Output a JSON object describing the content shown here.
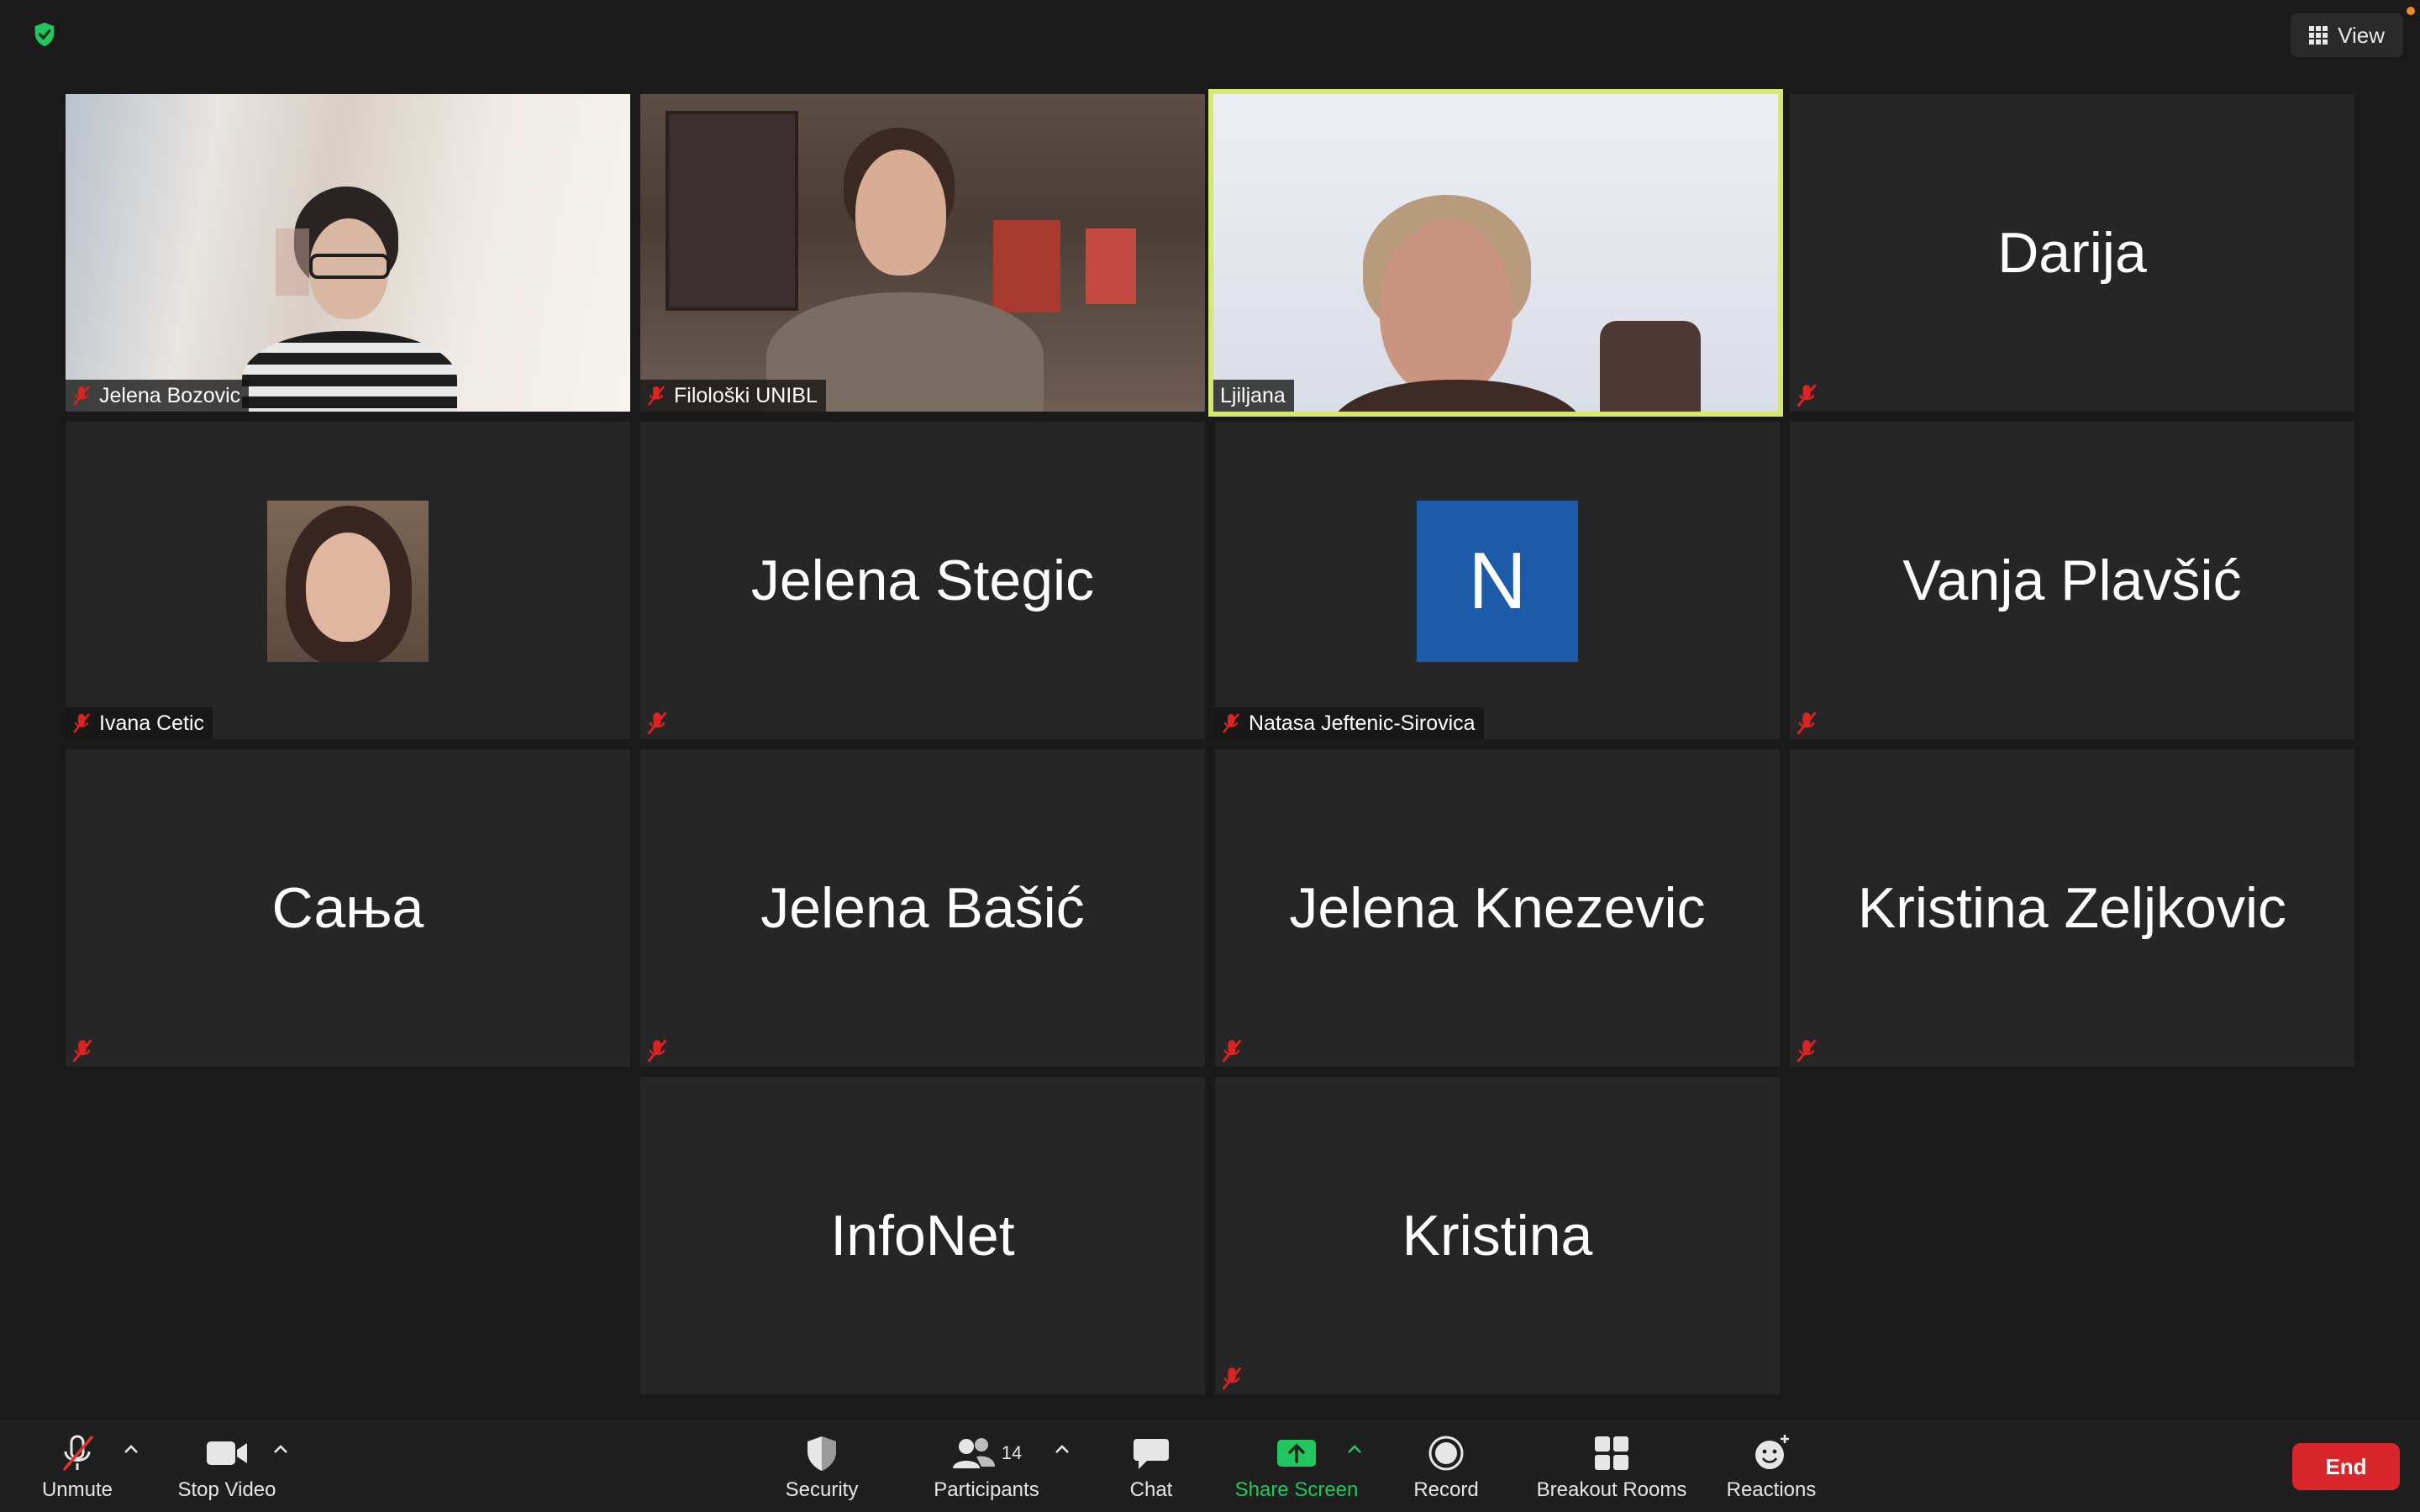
{
  "top": {
    "view_label": "View",
    "accent_green": "#22c55e",
    "active_border": "#d6e86f"
  },
  "tiles": [
    {
      "name": "Jelena Bozovic",
      "mode": "video"
    },
    {
      "name": "Filološki UNIBL",
      "mode": "video"
    },
    {
      "name": "Ljiljana",
      "mode": "video",
      "active": true
    },
    {
      "name": "Darija",
      "mode": "name"
    },
    {
      "name": "Ivana Cetic",
      "mode": "photo"
    },
    {
      "name": "Jelena Stegic",
      "mode": "name"
    },
    {
      "name": "Natasa Jeftenic-Sirovica",
      "mode": "avatar",
      "avatar_letter": "N",
      "avatar_color": "#1b5ba8"
    },
    {
      "name": "Vanja Plavšić",
      "mode": "name"
    },
    {
      "name": "Сања",
      "mode": "name"
    },
    {
      "name": "Jelena Bašić",
      "mode": "name"
    },
    {
      "name": "Jelena Knezevic",
      "mode": "name"
    },
    {
      "name": "Kristina Zeljkovic",
      "mode": "name"
    },
    {
      "name": "InfoNet",
      "mode": "name"
    },
    {
      "name": "Kristina",
      "mode": "name"
    }
  ],
  "toolbar": {
    "unmute": "Unmute",
    "stop_video": "Stop Video",
    "security": "Security",
    "participants": "Participants",
    "participants_count": "14",
    "chat": "Chat",
    "share_screen": "Share Screen",
    "record": "Record",
    "breakout_rooms": "Breakout Rooms",
    "reactions": "Reactions",
    "end": "End",
    "share_color": "#22c55e",
    "end_color": "#d9262b"
  }
}
